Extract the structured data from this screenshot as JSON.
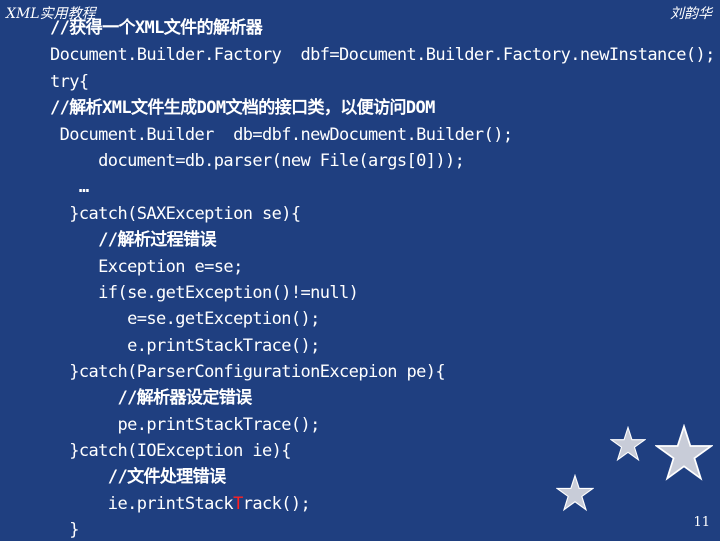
{
  "header": {
    "left_title": "XML实用教程",
    "right_author": "刘韵华"
  },
  "code": {
    "line1": "//获得一个XML文件的解析器",
    "line2": "Document.Builder.Factory  dbf=Document.Builder.Factory.newInstance();",
    "line3": "try{",
    "line4": "//解析XML文件生成DOM文档的接口类，以便访问DOM",
    "line5": " Document.Builder  db=dbf.newDocument.Builder();",
    "line6": "     document=db.parser(new File(args[0]));",
    "line7": "   …",
    "line8": "  }catch(SAXException se){",
    "line9": "     //解析过程错误",
    "line10": "     Exception e=se;",
    "line11": "     if(se.getException()!=null)",
    "line12": "        e=se.getException();",
    "line13": "        e.printStackTrace();",
    "line14": "  }catch(ParserConfigurationExcepion pe){",
    "line15": "       //解析器设定错误",
    "line16": "       pe.printStackTrace();",
    "line17": "  }catch(IOException ie){",
    "line18": "      //文件处理错误",
    "line19_before": "      ie.printStack",
    "line19_red": "T",
    "line19_after": "rack();",
    "line20": "  }"
  },
  "page_number": "11",
  "colors": {
    "background": "#1f3f80",
    "text": "#ffffff",
    "highlight": "#ff2020"
  },
  "decorations": [
    "star-icon",
    "star-icon",
    "star-icon"
  ]
}
